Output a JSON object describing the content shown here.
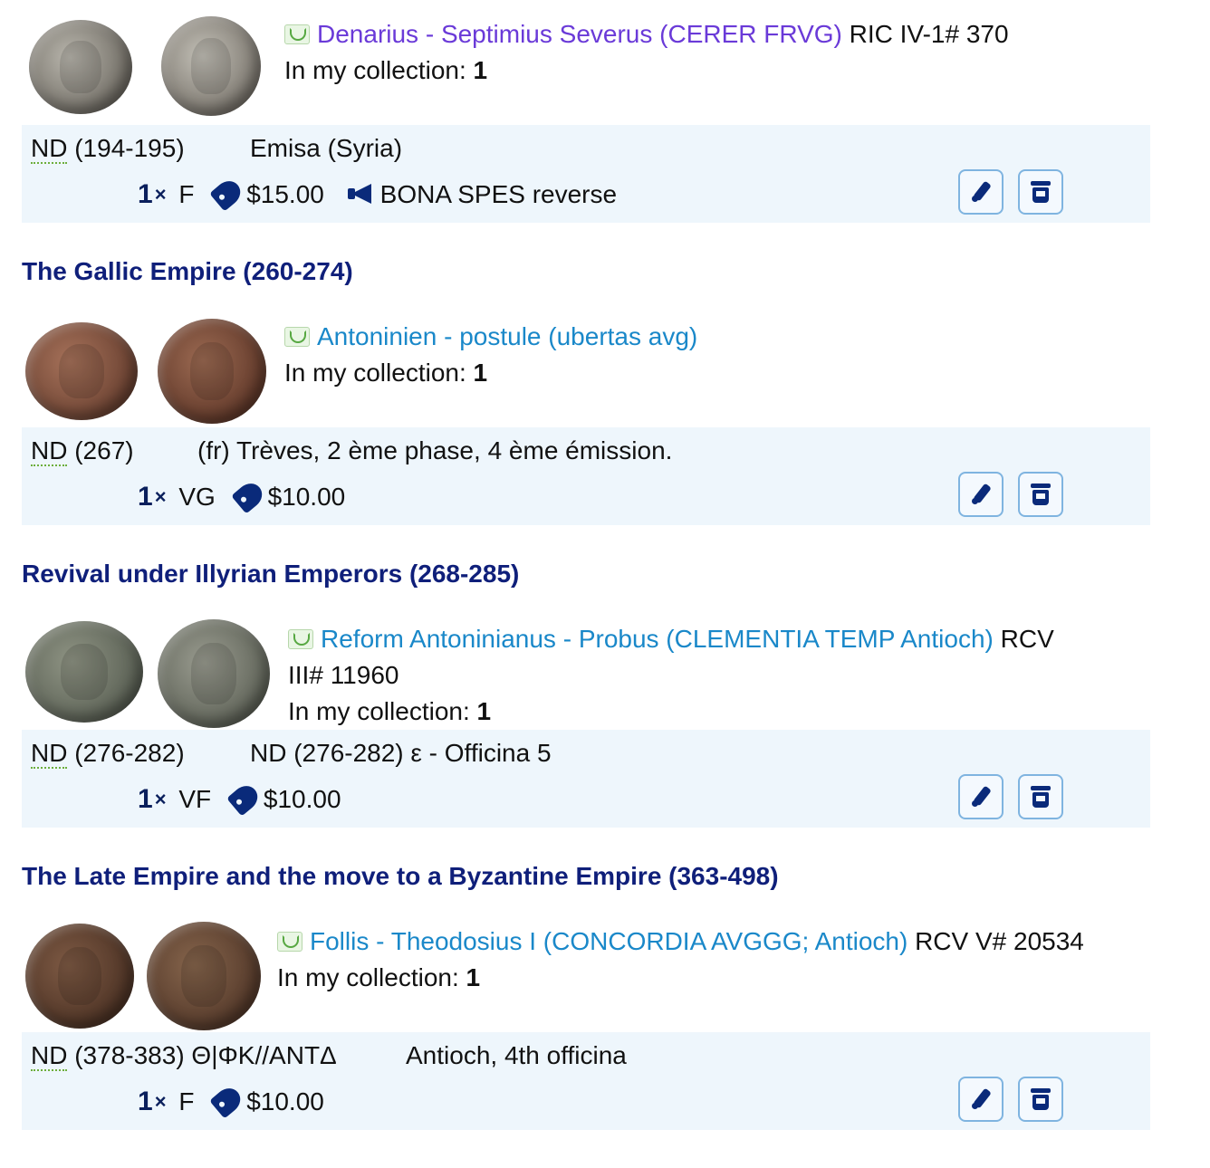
{
  "entries": [
    {
      "title": "Denarius - Septimius Severus (CERER FRVG)",
      "ref": "RIC IV-1# 370",
      "ref_wrap": "",
      "in_collection_label": "In my collection:",
      "in_collection_count": "1",
      "date_nd": "ND",
      "date_range": " (194-195)",
      "mint": "Emisa (Syria)",
      "quantity": "1",
      "quantity_sign": "×",
      "grade": "F",
      "price": "$15.00",
      "comment": "BONA SPES reverse"
    },
    {
      "title": "Antoninien - postule (ubertas avg)",
      "ref": "",
      "ref_wrap": "",
      "in_collection_label": "In my collection:",
      "in_collection_count": "1",
      "date_nd": "ND",
      "date_range": " (267)",
      "mint": "(fr) Trèves, 2 ème phase, 4 ème émission.",
      "quantity": "1",
      "quantity_sign": "×",
      "grade": "VG",
      "price": "$10.00",
      "comment": ""
    },
    {
      "title": "Reform Antoninianus - Probus (CLEMENTIA TEMP Antioch)",
      "ref": "RCV",
      "ref_wrap": "III# 11960",
      "in_collection_label": "In my collection:",
      "in_collection_count": "1",
      "date_nd": "ND",
      "date_range": " (276-282)",
      "mint": "ND (276-282) ε - Officina 5",
      "quantity": "1",
      "quantity_sign": "×",
      "grade": "VF",
      "price": "$10.00",
      "comment": ""
    },
    {
      "title": "Follis - Theodosius I (CONCORDIA AVGGG; Antioch)",
      "ref": "RCV V# 20534",
      "ref_wrap": "",
      "in_collection_label": "In my collection:",
      "in_collection_count": "1",
      "date_nd": "ND",
      "date_range": " (378-383) Θ|ΦΚ//ANTΔ",
      "mint": "Antioch, 4th officina",
      "quantity": "1",
      "quantity_sign": "×",
      "grade": "F",
      "price": "$10.00",
      "comment": ""
    }
  ],
  "sections": [
    "The Gallic Empire (260-274)",
    "Revival under Illyrian Emperors (268-285)",
    "The Late Empire and the move to a Byzantine Empire (363-498)"
  ],
  "icons": {
    "status": "eye-icon",
    "price": "tag-icon",
    "comment": "megaphone-icon",
    "edit": "pencil-icon",
    "delete": "trash-icon"
  },
  "colors": {
    "link_visited": "#6a3ad8",
    "link": "#1a88c9",
    "section_title": "#0f1f7a",
    "band": "#eef6fc",
    "button_border": "#7fb4e0",
    "icon": "#0a2a7a"
  }
}
